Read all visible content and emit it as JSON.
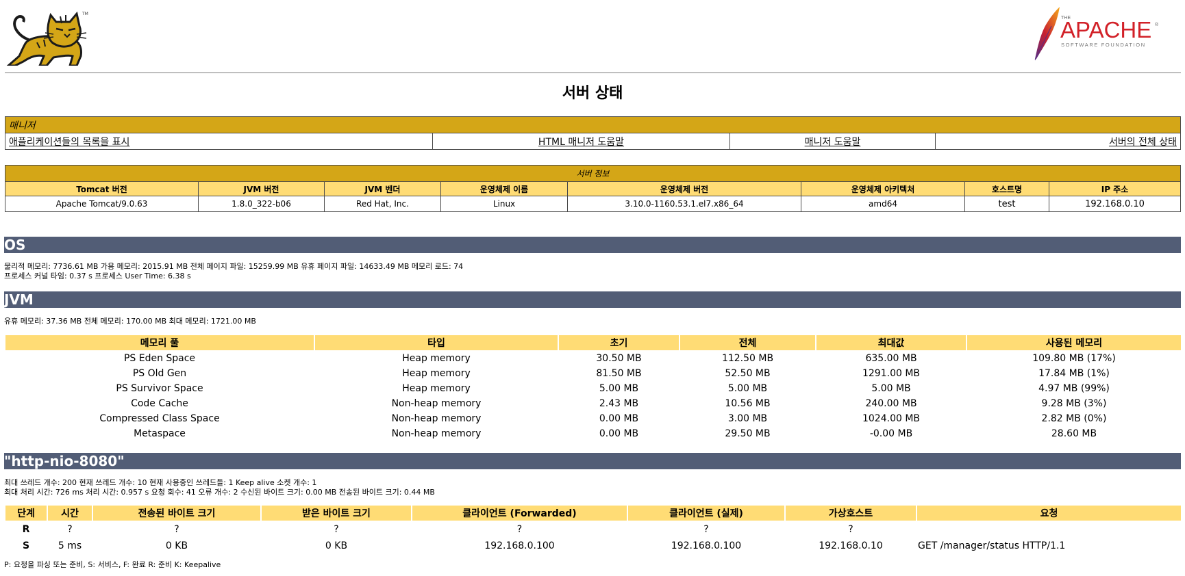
{
  "page_title": "서버 상태",
  "manager": {
    "title": "매니저",
    "links": [
      "애플리케이션들의 목록을 표시",
      "HTML 매니저 도움말",
      "매니저 도움말",
      "서버의 전체 상태"
    ]
  },
  "server_info": {
    "title": "서버 정보",
    "headers": [
      "Tomcat 버전",
      "JVM 버전",
      "JVM 벤더",
      "운영체제 이름",
      "운영체제 버전",
      "운영체제 아키텍처",
      "호스트명",
      "IP 주소"
    ],
    "values": [
      "Apache Tomcat/9.0.63",
      "1.8.0_322-b06",
      "Red Hat, Inc.",
      "Linux",
      "3.10.0-1160.53.1.el7.x86_64",
      "amd64",
      "test",
      "192.168.0.10"
    ]
  },
  "os": {
    "title": "OS",
    "line1": "물리적 메모리: 7736.61 MB 가용 메모리: 2015.91 MB 전체 페이지 파일: 15259.99 MB 유휴 페이지 파일: 14633.49 MB 메모리 로드: 74",
    "line2": "프로세스 커널 타임: 0.37 s 프로세스 User Time: 6.38 s"
  },
  "jvm": {
    "title": "JVM",
    "line1": "유휴 메모리: 37.36 MB 전체 메모리: 170.00 MB 최대 메모리: 1721.00 MB",
    "headers": [
      "메모리 풀",
      "타입",
      "초기",
      "전체",
      "최대값",
      "사용된 메모리"
    ],
    "rows": [
      [
        "PS Eden Space",
        "Heap memory",
        "30.50 MB",
        "112.50 MB",
        "635.00 MB",
        "109.80 MB (17%)"
      ],
      [
        "PS Old Gen",
        "Heap memory",
        "81.50 MB",
        "52.50 MB",
        "1291.00 MB",
        "17.84 MB (1%)"
      ],
      [
        "PS Survivor Space",
        "Heap memory",
        "5.00 MB",
        "5.00 MB",
        "5.00 MB",
        "4.97 MB (99%)"
      ],
      [
        "Code Cache",
        "Non-heap memory",
        "2.43 MB",
        "10.56 MB",
        "240.00 MB",
        "9.28 MB (3%)"
      ],
      [
        "Compressed Class Space",
        "Non-heap memory",
        "0.00 MB",
        "3.00 MB",
        "1024.00 MB",
        "2.82 MB (0%)"
      ],
      [
        "Metaspace",
        "Non-heap memory",
        "0.00 MB",
        "29.50 MB",
        "-0.00 MB",
        "28.60 MB"
      ]
    ]
  },
  "connector": {
    "title": "\"http-nio-8080\"",
    "line1": "최대 쓰레드 개수: 200 현재 쓰레드 개수: 10 현재 사용중인 쓰레드들: 1 Keep alive 소켓 개수: 1",
    "line2": "최대 처리 시간: 726 ms 처리 시간: 0.957 s 요청 회수: 41 오류 개수: 2 수신된 바이트 크기: 0.00 MB 전송된 바이트 크기: 0.44 MB",
    "headers": [
      "단계",
      "시간",
      "전송된 바이트 크기",
      "받은 바이트 크기",
      "클라이언트 (Forwarded)",
      "클라이언트 (실제)",
      "가상호스트",
      "요청"
    ],
    "rows": [
      [
        "R",
        "?",
        "?",
        "?",
        "?",
        "?",
        "?",
        ""
      ],
      [
        "S",
        "5 ms",
        "0 KB",
        "0 KB",
        "192.168.0.100",
        "192.168.0.100",
        "192.168.0.10",
        "GET /manager/status HTTP/1.1"
      ]
    ],
    "legend": "P: 요청을 파싱 또는 준비, S: 서비스, F: 완료 R: 준비 K: Keepalive"
  },
  "apache_logo": {
    "the": "THE",
    "name": "APACHE",
    "tm": "®",
    "sub": "SOFTWARE FOUNDATION"
  },
  "tomcat_logo": {
    "tm": "TM"
  },
  "colors": {
    "section_title": "#d4a617",
    "table_header": "#ffdc75",
    "bar": "#525d76",
    "apache_red": "#d22128"
  }
}
